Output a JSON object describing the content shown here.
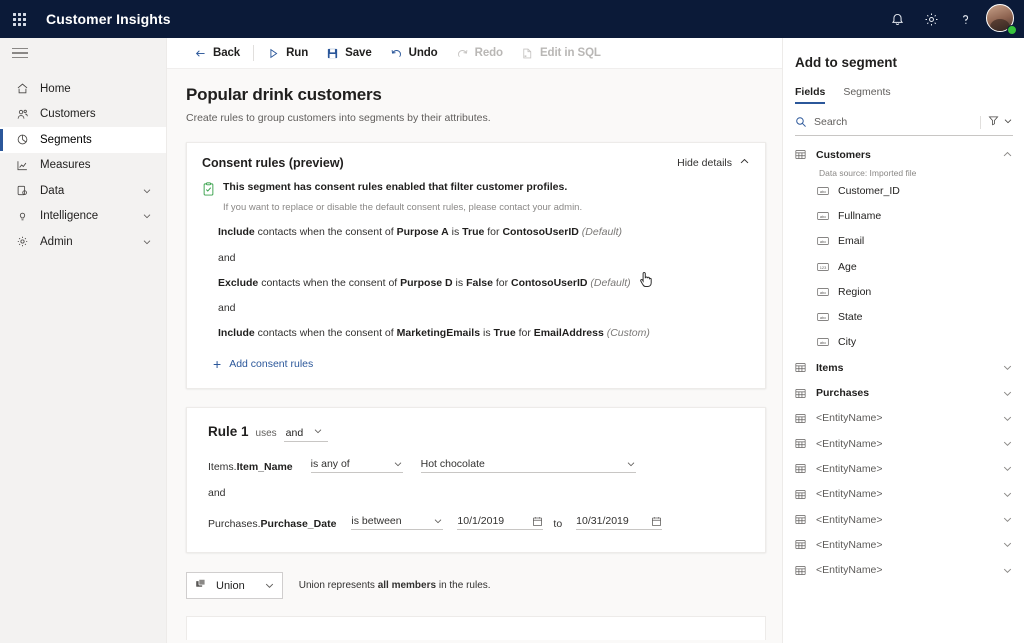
{
  "topbar": {
    "waffle_label": "app-launcher",
    "app_title": "Customer Insights",
    "icons": [
      {
        "name": "notifications-icon",
        "glyph": "bell"
      },
      {
        "name": "settings-icon",
        "glyph": "gear"
      },
      {
        "name": "help-icon",
        "glyph": "question"
      }
    ],
    "account_label": "account-avatar"
  },
  "leftnav": {
    "menu_label": "menu",
    "items": [
      {
        "label": "Home",
        "icon": "home-icon",
        "active": false,
        "expandable": false
      },
      {
        "label": "Customers",
        "icon": "people-icon",
        "active": false,
        "expandable": false
      },
      {
        "label": "Segments",
        "icon": "segments-icon",
        "active": true,
        "expandable": false
      },
      {
        "label": "Measures",
        "icon": "measures-icon",
        "active": false,
        "expandable": false
      },
      {
        "label": "Data",
        "icon": "data-icon",
        "active": false,
        "expandable": true
      },
      {
        "label": "Intelligence",
        "icon": "lightbulb-icon",
        "active": false,
        "expandable": true
      },
      {
        "label": "Admin",
        "icon": "gear-icon",
        "active": false,
        "expandable": true
      }
    ]
  },
  "toolbar": {
    "back": "Back",
    "run": "Run",
    "save": "Save",
    "undo": "Undo",
    "redo": "Redo",
    "edit_in_sql": "Edit in SQL"
  },
  "page": {
    "title": "Popular drink customers",
    "subtitle": "Create rules to group customers into segments by their attributes."
  },
  "consent_card": {
    "title": "Consent rules (preview)",
    "hide_details": "Hide details",
    "status_text": "This segment has consent rules enabled that filter customer profiles.",
    "status_note": "If you want to replace or disable the default consent rules, please contact your admin.",
    "rules": [
      {
        "action": "Include",
        "mid1": " contacts when the consent of ",
        "purpose": "Purpose A",
        "mid2": " is ",
        "value": "True",
        "mid3": " for ",
        "identifier": "ContosoUserID",
        "tag": "(Default)"
      },
      {
        "action": "Exclude",
        "mid1": " contacts when the consent of ",
        "purpose": "Purpose D",
        "mid2": " is ",
        "value": "False",
        "mid3": " for ",
        "identifier": "ContosoUserID",
        "tag": "(Default)"
      },
      {
        "action": "Include",
        "mid1": " contacts when the consent of ",
        "purpose": "MarketingEmails",
        "mid2": " is ",
        "value": "True",
        "mid3": " for ",
        "identifier": "EmailAddress",
        "tag": "(Custom)"
      }
    ],
    "connector": "and",
    "add_consent_rules": "Add consent rules"
  },
  "rule_card": {
    "rule_name": "Rule 1",
    "uses_label": "uses",
    "operator": "and",
    "conditions": [
      {
        "field_entity": "Items.",
        "field_attr": "Item_Name",
        "operator": "is any of",
        "value": "Hot chocolate"
      },
      {
        "field_entity": "Purchases.",
        "field_attr": "Purchase_Date",
        "operator": "is between",
        "date_from": "10/1/2019",
        "to_label": "to",
        "date_to": "10/31/2019"
      }
    ],
    "connector": "and"
  },
  "union_bar": {
    "button_label": "Union",
    "note_pre": "Union represents ",
    "note_bold": "all members",
    "note_post": " in the rules."
  },
  "right_panel": {
    "title": "Add to segment",
    "tabs": [
      {
        "label": "Fields",
        "active": true
      },
      {
        "label": "Segments",
        "active": false
      }
    ],
    "search_placeholder": "Search",
    "filter_label": "filter",
    "entities": [
      {
        "name": "Customers",
        "expanded": true,
        "data_source": "Data source: Imported file",
        "fields": [
          {
            "label": "Customer_ID",
            "type": "text"
          },
          {
            "label": "Fullname",
            "type": "text"
          },
          {
            "label": "Email",
            "type": "text"
          },
          {
            "label": "Age",
            "type": "number"
          },
          {
            "label": "Region",
            "type": "text"
          },
          {
            "label": "State",
            "type": "text"
          },
          {
            "label": "City",
            "type": "text"
          }
        ]
      },
      {
        "name": "Items",
        "expanded": false,
        "placeholder": false
      },
      {
        "name": "Purchases",
        "expanded": false,
        "placeholder": false
      },
      {
        "name": "<EntityName>",
        "expanded": false,
        "placeholder": true
      },
      {
        "name": "<EntityName>",
        "expanded": false,
        "placeholder": true
      },
      {
        "name": "<EntityName>",
        "expanded": false,
        "placeholder": true
      },
      {
        "name": "<EntityName>",
        "expanded": false,
        "placeholder": true
      },
      {
        "name": "<EntityName>",
        "expanded": false,
        "placeholder": true
      },
      {
        "name": "<EntityName>",
        "expanded": false,
        "placeholder": true
      },
      {
        "name": "<EntityName>",
        "expanded": false,
        "placeholder": true
      }
    ]
  },
  "colors": {
    "brand_navy": "#0b1a38",
    "accent_blue": "#2b579a",
    "consent_green": "#37a04a",
    "presence_green": "#37c23c",
    "canvas_bg": "#faf9f8",
    "nav_bg": "#f3f2f1"
  }
}
